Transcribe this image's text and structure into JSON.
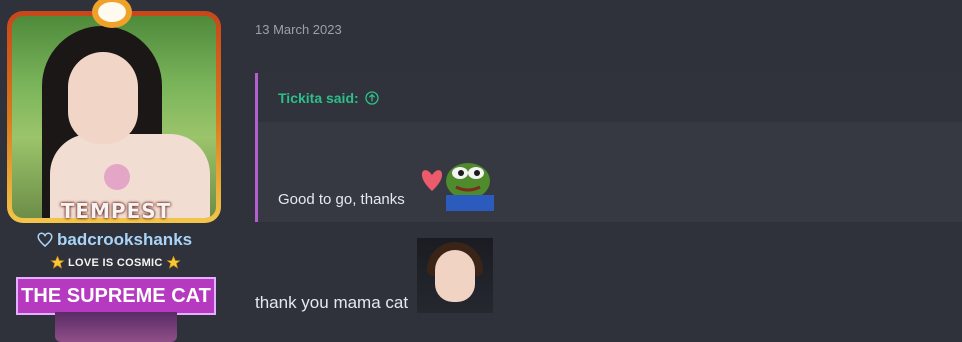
{
  "sidebar": {
    "avatar_caption": "TEMPEST",
    "username": "badcrookshanks",
    "user_title": "LOVE IS COSMIC",
    "banner_text": "THE SUPREME CAT"
  },
  "post": {
    "date": "13 March 2023",
    "quote": {
      "author": "Tickita said:",
      "text": "Good to go, thanks"
    },
    "message": "thank you mama cat"
  },
  "icons": {
    "heart": "heart-outline-icon",
    "star": "star-icon",
    "arrow": "arrow-up-circle-icon"
  },
  "colors": {
    "background": "#2f323b",
    "username": "#a9d4f7",
    "quote_author": "#2dbf8a",
    "quote_border": "#b45ed1",
    "banner": "#b63ac0"
  }
}
